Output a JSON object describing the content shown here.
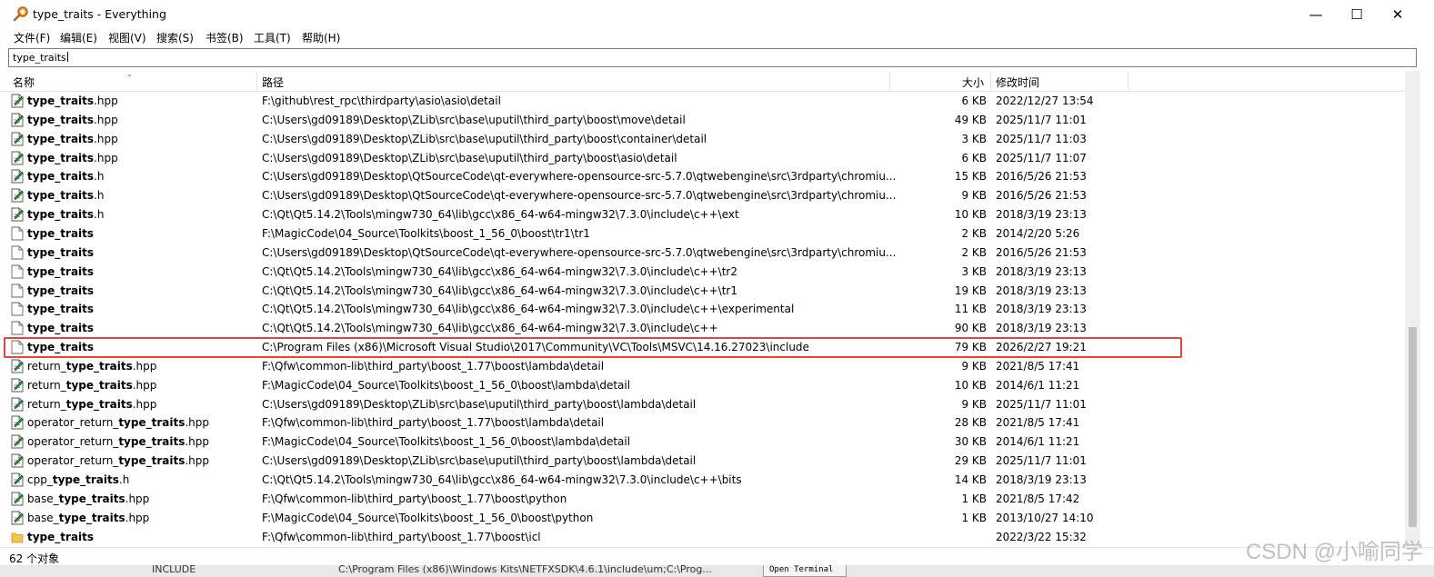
{
  "window": {
    "title": "type_traits - Everything",
    "minimize": "—",
    "maximize": "☐",
    "close": "✕"
  },
  "menu": [
    "文件(F)",
    "编辑(E)",
    "视图(V)",
    "搜索(S)",
    "书签(B)",
    "工具(T)",
    "帮助(H)"
  ],
  "search": {
    "value": "type_traits"
  },
  "columns": {
    "name": "名称",
    "path": "路径",
    "size": "大小",
    "modified": "修改时间"
  },
  "rows": [
    {
      "pre": "",
      "bold": "type_traits",
      "post": ".hpp",
      "path": "F:\\github\\rest_rpc\\thirdparty\\asio\\asio\\detail",
      "size": "6 KB",
      "date": "2022/12/27 13:54",
      "icon": "cpp-file-icon"
    },
    {
      "pre": "",
      "bold": "type_traits",
      "post": ".hpp",
      "path": "C:\\Users\\gd09189\\Desktop\\ZLib\\src\\base\\uputil\\third_party\\boost\\move\\detail",
      "size": "49 KB",
      "date": "2025/11/7 11:01",
      "icon": "cpp-file-icon"
    },
    {
      "pre": "",
      "bold": "type_traits",
      "post": ".hpp",
      "path": "C:\\Users\\gd09189\\Desktop\\ZLib\\src\\base\\uputil\\third_party\\boost\\container\\detail",
      "size": "3 KB",
      "date": "2025/11/7 11:03",
      "icon": "cpp-file-icon"
    },
    {
      "pre": "",
      "bold": "type_traits",
      "post": ".hpp",
      "path": "C:\\Users\\gd09189\\Desktop\\ZLib\\src\\base\\uputil\\third_party\\boost\\asio\\detail",
      "size": "6 KB",
      "date": "2025/11/7 11:07",
      "icon": "cpp-file-icon"
    },
    {
      "pre": "",
      "bold": "type_traits",
      "post": ".h",
      "path": "C:\\Users\\gd09189\\Desktop\\QtSourceCode\\qt-everywhere-opensource-src-5.7.0\\qtwebengine\\src\\3rdparty\\chromiu...",
      "size": "15 KB",
      "date": "2016/5/26 21:53",
      "icon": "cpp-file-icon"
    },
    {
      "pre": "",
      "bold": "type_traits",
      "post": ".h",
      "path": "C:\\Users\\gd09189\\Desktop\\QtSourceCode\\qt-everywhere-opensource-src-5.7.0\\qtwebengine\\src\\3rdparty\\chromiu...",
      "size": "9 KB",
      "date": "2016/5/26 21:53",
      "icon": "cpp-file-icon"
    },
    {
      "pre": "",
      "bold": "type_traits",
      "post": ".h",
      "path": "C:\\Qt\\Qt5.14.2\\Tools\\mingw730_64\\lib\\gcc\\x86_64-w64-mingw32\\7.3.0\\include\\c++\\ext",
      "size": "10 KB",
      "date": "2018/3/19 23:13",
      "icon": "cpp-file-icon"
    },
    {
      "pre": "",
      "bold": "type_traits",
      "post": "",
      "path": "F:\\MagicCode\\04_Source\\Toolkits\\boost_1_56_0\\boost\\tr1\\tr1",
      "size": "2 KB",
      "date": "2014/2/20 5:26",
      "icon": "blank-file-icon"
    },
    {
      "pre": "",
      "bold": "type_traits",
      "post": "",
      "path": "C:\\Users\\gd09189\\Desktop\\QtSourceCode\\qt-everywhere-opensource-src-5.7.0\\qtwebengine\\src\\3rdparty\\chromiu...",
      "size": "2 KB",
      "date": "2016/5/26 21:53",
      "icon": "blank-file-icon"
    },
    {
      "pre": "",
      "bold": "type_traits",
      "post": "",
      "path": "C:\\Qt\\Qt5.14.2\\Tools\\mingw730_64\\lib\\gcc\\x86_64-w64-mingw32\\7.3.0\\include\\c++\\tr2",
      "size": "3 KB",
      "date": "2018/3/19 23:13",
      "icon": "blank-file-icon"
    },
    {
      "pre": "",
      "bold": "type_traits",
      "post": "",
      "path": "C:\\Qt\\Qt5.14.2\\Tools\\mingw730_64\\lib\\gcc\\x86_64-w64-mingw32\\7.3.0\\include\\c++\\tr1",
      "size": "19 KB",
      "date": "2018/3/19 23:13",
      "icon": "blank-file-icon"
    },
    {
      "pre": "",
      "bold": "type_traits",
      "post": "",
      "path": "C:\\Qt\\Qt5.14.2\\Tools\\mingw730_64\\lib\\gcc\\x86_64-w64-mingw32\\7.3.0\\include\\c++\\experimental",
      "size": "11 KB",
      "date": "2018/3/19 23:13",
      "icon": "blank-file-icon"
    },
    {
      "pre": "",
      "bold": "type_traits",
      "post": "",
      "path": "C:\\Qt\\Qt5.14.2\\Tools\\mingw730_64\\lib\\gcc\\x86_64-w64-mingw32\\7.3.0\\include\\c++",
      "size": "90 KB",
      "date": "2018/3/19 23:13",
      "icon": "blank-file-icon"
    },
    {
      "pre": "",
      "bold": "type_traits",
      "post": "",
      "path": "C:\\Program Files (x86)\\Microsoft Visual Studio\\2017\\Community\\VC\\Tools\\MSVC\\14.16.27023\\include",
      "size": "79 KB",
      "date": "2026/2/27 19:21",
      "icon": "blank-file-icon"
    },
    {
      "pre": "return_",
      "bold": "type_traits",
      "post": ".hpp",
      "path": "F:\\Qfw\\common-lib\\third_party\\boost_1.77\\boost\\lambda\\detail",
      "size": "9 KB",
      "date": "2021/8/5 17:41",
      "icon": "cpp-file-icon"
    },
    {
      "pre": "return_",
      "bold": "type_traits",
      "post": ".hpp",
      "path": "F:\\MagicCode\\04_Source\\Toolkits\\boost_1_56_0\\boost\\lambda\\detail",
      "size": "10 KB",
      "date": "2014/6/1 11:21",
      "icon": "cpp-file-icon"
    },
    {
      "pre": "return_",
      "bold": "type_traits",
      "post": ".hpp",
      "path": "C:\\Users\\gd09189\\Desktop\\ZLib\\src\\base\\uputil\\third_party\\boost\\lambda\\detail",
      "size": "9 KB",
      "date": "2025/11/7 11:01",
      "icon": "cpp-file-icon"
    },
    {
      "pre": "operator_return_",
      "bold": "type_traits",
      "post": ".hpp",
      "path": "F:\\Qfw\\common-lib\\third_party\\boost_1.77\\boost\\lambda\\detail",
      "size": "28 KB",
      "date": "2021/8/5 17:41",
      "icon": "cpp-file-icon"
    },
    {
      "pre": "operator_return_",
      "bold": "type_traits",
      "post": ".hpp",
      "path": "F:\\MagicCode\\04_Source\\Toolkits\\boost_1_56_0\\boost\\lambda\\detail",
      "size": "30 KB",
      "date": "2014/6/1 11:21",
      "icon": "cpp-file-icon"
    },
    {
      "pre": "operator_return_",
      "bold": "type_traits",
      "post": ".hpp",
      "path": "C:\\Users\\gd09189\\Desktop\\ZLib\\src\\base\\uputil\\third_party\\boost\\lambda\\detail",
      "size": "29 KB",
      "date": "2025/11/7 11:01",
      "icon": "cpp-file-icon"
    },
    {
      "pre": "cpp_",
      "bold": "type_traits",
      "post": ".h",
      "path": "C:\\Qt\\Qt5.14.2\\Tools\\mingw730_64\\lib\\gcc\\x86_64-w64-mingw32\\7.3.0\\include\\c++\\bits",
      "size": "14 KB",
      "date": "2018/3/19 23:13",
      "icon": "cpp-file-icon"
    },
    {
      "pre": "base_",
      "bold": "type_traits",
      "post": ".hpp",
      "path": "F:\\Qfw\\common-lib\\third_party\\boost_1.77\\boost\\python",
      "size": "1 KB",
      "date": "2021/8/5 17:42",
      "icon": "cpp-file-icon"
    },
    {
      "pre": "base_",
      "bold": "type_traits",
      "post": ".hpp",
      "path": "F:\\MagicCode\\04_Source\\Toolkits\\boost_1_56_0\\boost\\python",
      "size": "1 KB",
      "date": "2013/10/27 14:10",
      "icon": "cpp-file-icon"
    },
    {
      "pre": "",
      "bold": "type_traits",
      "post": "",
      "path": "F:\\Qfw\\common-lib\\third_party\\boost_1.77\\boost\\icl",
      "size": "",
      "date": "2022/3/22 15:32",
      "icon": "folder-icon"
    }
  ],
  "status": "62 个对象",
  "background_window": {
    "col_a": "INCLUDE",
    "col_b": "C:\\Program Files (x86)\\Windows Kits\\NETFXSDK\\4.6.1\\include\\um;C:\\Prog...",
    "button": "Open Terminal"
  },
  "watermark": "CSDN @小喻同学"
}
